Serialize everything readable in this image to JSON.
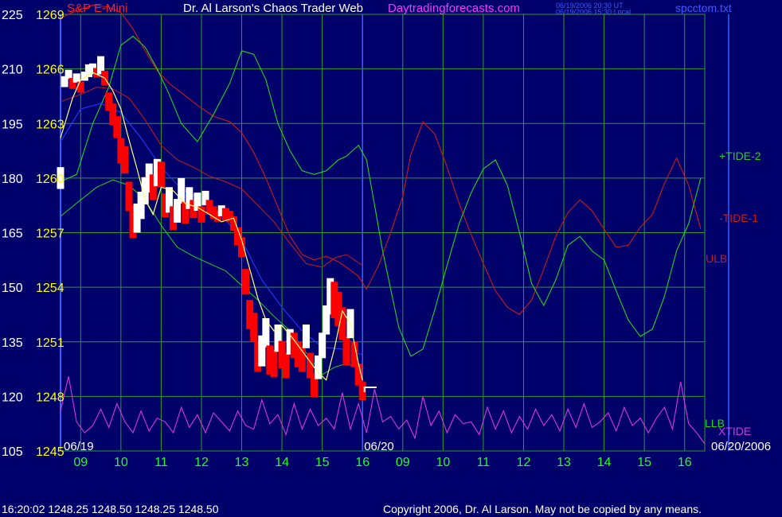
{
  "header": {
    "symbol": "S&P E-Mini",
    "title": "Dr. Al Larson's Chaos Trader Web",
    "site": "Daytradingforecasts.com",
    "stamp_ut": "06/19/2006 20:30 UT",
    "stamp_local": "06/19/2006 15:30 Local",
    "file": "spcctom.txt"
  },
  "footer": {
    "quote": "16:20:02  1248.25  1248.50  1248.25  1248.50",
    "copyright": "Copyright 2006, Dr. Al Larson. May not be copied by any means."
  },
  "colors": {
    "background": "#00006a",
    "grid": "#2f9a2f",
    "price_bars_up": "#ffffff",
    "price_bars_down": "#ff0000",
    "plus_tide_2": "#22d322",
    "minus_tide_1": "#cc1a1a",
    "xtide": "#dd33dd",
    "average": "#ffff80",
    "slow_average": "#1e3cff",
    "axis_text_left": "#ffffff",
    "axis_text_right": "#ffff00",
    "time_text": "#22ff22"
  },
  "chart_data": {
    "type": "line",
    "left_axis_ticks": [
      "225",
      "210",
      "195",
      "180",
      "165",
      "150",
      "135",
      "120",
      "105"
    ],
    "price_axis_ticks": [
      "1269",
      "1266",
      "1263",
      "1260",
      "1257",
      "1254",
      "1251",
      "1248",
      "1245"
    ],
    "price_range": [
      1245,
      1269
    ],
    "xtide_range": [
      105,
      225
    ],
    "x_ticks": [
      "09",
      "10",
      "11",
      "12",
      "13",
      "14",
      "15",
      "16",
      "09",
      "10",
      "11",
      "12",
      "13",
      "14",
      "15",
      "16"
    ],
    "x_range_hours": [
      8.5,
      24.5
    ],
    "date_labels": [
      "06/19",
      "06/20",
      "06/20/2006"
    ],
    "grid": true,
    "series_labels": [
      "+TIDE-2",
      "-TIDE-1",
      "ULB",
      "LLB",
      "XTIDE"
    ],
    "plus_tide_2": {
      "x": [
        8.5,
        8.9,
        9.3,
        9.7,
        10,
        10.3,
        10.6,
        10.9,
        11.2,
        11.5,
        11.9,
        12.3,
        12.7,
        13.0,
        13.3,
        13.6,
        13.9,
        14.2,
        14.5,
        14.8,
        15.1,
        15.4,
        15.6,
        15.9,
        16.1,
        16.5,
        16.9,
        17.2,
        17.5,
        17.8,
        18.1,
        18.4,
        18.7,
        19.0,
        19.3,
        19.6,
        19.9,
        20.2,
        20.5,
        20.8,
        21.1,
        21.4,
        21.7,
        22.0,
        22.3,
        22.6,
        22.9,
        23.2,
        23.5,
        23.8,
        24.1,
        24.4
      ],
      "y": [
        1259.8,
        1260.2,
        1263.0,
        1265.0,
        1267.3,
        1267.8,
        1267.2,
        1266.0,
        1264.6,
        1263.0,
        1262.0,
        1263.5,
        1265.2,
        1267.0,
        1266.8,
        1265.4,
        1263.0,
        1261.5,
        1260.4,
        1260.2,
        1260.4,
        1261.0,
        1261.2,
        1261.8,
        1261.0,
        1256.0,
        1251.8,
        1250.2,
        1250.6,
        1252.8,
        1255.2,
        1257.5,
        1259.2,
        1260.5,
        1261.0,
        1259.6,
        1257.0,
        1254.2,
        1253.0,
        1254.4,
        1256.3,
        1256.8,
        1256.0,
        1255.5,
        1253.8,
        1252.2,
        1251.3,
        1251.7,
        1253.5,
        1256.0,
        1257.5,
        1260.0
      ]
    },
    "minus_tide_1": {
      "x": [
        8.5,
        8.9,
        9.3,
        9.7,
        10,
        10.3,
        10.6,
        10.9,
        11.2,
        11.5,
        11.9,
        12.3,
        12.7,
        13.0,
        13.3,
        13.6,
        13.9,
        14.2,
        14.5,
        14.8,
        15.1,
        15.4,
        15.6,
        15.9,
        16.1,
        16.4,
        16.7,
        17.0,
        17.2,
        17.5,
        17.8,
        18.1,
        18.4,
        18.7,
        19.0,
        19.3,
        19.6,
        19.9,
        20.2,
        20.5,
        20.8,
        21.1,
        21.4,
        21.7,
        22.0,
        22.3,
        22.6,
        22.9,
        23.2,
        23.5,
        23.8,
        24.1,
        24.4
      ],
      "y": [
        1268.8,
        1269.2,
        1269.5,
        1269.4,
        1269.1,
        1268.2,
        1267.0,
        1265.9,
        1265.2,
        1264.7,
        1264.0,
        1263.4,
        1263.1,
        1262.5,
        1261.4,
        1260.0,
        1258.4,
        1256.8,
        1255.8,
        1255.5,
        1255.7,
        1255.4,
        1255.1,
        1254.6,
        1253.9,
        1255.2,
        1257.0,
        1259.0,
        1261.3,
        1263.1,
        1262.4,
        1260.6,
        1258.6,
        1256.9,
        1255.3,
        1253.8,
        1252.9,
        1252.5,
        1253.3,
        1255.0,
        1256.8,
        1258.1,
        1258.8,
        1258.2,
        1257.2,
        1256.2,
        1256.3,
        1257.3,
        1258.0,
        1259.7,
        1261.1,
        1259.6,
        1257.2
      ]
    },
    "ulb": {
      "x": [
        8.5,
        9.0,
        9.4,
        9.8,
        10.2,
        10.6,
        11.0,
        11.4,
        11.8,
        12.2,
        12.6,
        13.0,
        13.4,
        13.8,
        14.2,
        14.6,
        15.0,
        15.3,
        15.6,
        16.0
      ],
      "y": [
        1264.2,
        1264.6,
        1265.0,
        1264.9,
        1264.4,
        1263.2,
        1261.8,
        1261.0,
        1260.6,
        1260.1,
        1259.8,
        1259.4,
        1258.5,
        1257.6,
        1256.4,
        1255.3,
        1255.1,
        1255.6,
        1255.8,
        1255.2
      ]
    },
    "llb": {
      "x": [
        8.5,
        9.0,
        9.4,
        9.8,
        10.2,
        10.6,
        11.0,
        11.4,
        11.8,
        12.2,
        12.6,
        13.0,
        13.4,
        13.8,
        14.2,
        14.6,
        15.0,
        15.3,
        15.6,
        16.0
      ],
      "y": [
        1257.9,
        1258.8,
        1259.5,
        1259.9,
        1259.6,
        1258.8,
        1257.4,
        1256.2,
        1255.7,
        1255.3,
        1254.9,
        1254.1,
        1253.3,
        1252.4,
        1251.6,
        1250.4,
        1249.2,
        1249.6,
        1249.8,
        1249.5
      ]
    },
    "xtide": {
      "x": [
        8.5,
        8.7,
        8.9,
        9.1,
        9.3,
        9.5,
        9.7,
        9.9,
        10.1,
        10.3,
        10.5,
        10.7,
        10.9,
        11.1,
        11.3,
        11.5,
        11.7,
        11.9,
        12.1,
        12.3,
        12.5,
        12.7,
        12.9,
        13.1,
        13.3,
        13.5,
        13.7,
        13.9,
        14.1,
        14.3,
        14.5,
        14.7,
        14.9,
        15.1,
        15.3,
        15.5,
        15.7,
        15.9,
        16.1,
        16.3,
        16.5,
        16.7,
        16.9,
        17.1,
        17.3,
        17.5,
        17.7,
        17.9,
        18.1,
        18.3,
        18.5,
        18.7,
        18.9,
        19.1,
        19.3,
        19.5,
        19.7,
        19.9,
        20.1,
        20.3,
        20.5,
        20.7,
        20.9,
        21.1,
        21.3,
        21.5,
        21.7,
        21.9,
        22.1,
        22.3,
        22.5,
        22.7,
        22.9,
        23.1,
        23.3,
        23.5,
        23.7,
        23.9,
        24.1,
        24.3,
        24.5
      ],
      "y": [
        116.0,
        125.5,
        113.0,
        110.0,
        112.0,
        116.5,
        111.5,
        118.0,
        113.0,
        110.0,
        116.0,
        110.5,
        114.0,
        113.0,
        110.0,
        117.0,
        111.5,
        115.0,
        110.0,
        115.5,
        113.0,
        110.5,
        116.0,
        112.0,
        111.0,
        119.0,
        112.5,
        115.0,
        109.5,
        118.0,
        111.0,
        116.5,
        112.0,
        114.0,
        111.0,
        121.0,
        111.0,
        118.0,
        110.0,
        122.0,
        113.0,
        114.5,
        111.0,
        113.5,
        108.5,
        120.0,
        112.0,
        116.0,
        110.0,
        115.0,
        112.5,
        113.0,
        109.5,
        117.0,
        111.0,
        116.0,
        110.0,
        114.5,
        111.0,
        116.5,
        112.0,
        115.0,
        110.5,
        116.5,
        111.5,
        118.0,
        111.5,
        113.0,
        115.5,
        110.5,
        117.0,
        112.0,
        114.0,
        110.0,
        114.0,
        117.0,
        111.0,
        124.0,
        112.5,
        110.0,
        107.0
      ]
    },
    "slow_average": {
      "x": [
        8.5,
        9.0,
        9.5,
        10.0,
        10.5,
        11.0,
        11.5,
        12.0,
        12.5,
        13.0,
        13.5,
        14.0,
        14.5,
        15.0,
        15.5,
        16.0
      ],
      "y": [
        1262.0,
        1263.8,
        1264.1,
        1263.6,
        1262.2,
        1260.6,
        1259.4,
        1258.8,
        1258.0,
        1256.6,
        1254.4,
        1252.9,
        1251.6,
        1250.7,
        1250.6,
        1250.3
      ]
    },
    "average": {
      "x": [
        8.5,
        8.8,
        9.0,
        9.3,
        9.6,
        9.8,
        10.0,
        10.2,
        10.4,
        10.6,
        10.8,
        11.0,
        11.3,
        11.6,
        11.9,
        12.2,
        12.5,
        12.8,
        13.0,
        13.2,
        13.4,
        13.6,
        13.8,
        14.0,
        14.3,
        14.6,
        14.9,
        15.1,
        15.3,
        15.5,
        15.7,
        15.9,
        16.0
      ],
      "y": [
        1262.2,
        1264.4,
        1265.4,
        1265.8,
        1265.5,
        1264.8,
        1263.8,
        1262.1,
        1260.5,
        1258.8,
        1258.0,
        1259.5,
        1259.3,
        1258.6,
        1258.4,
        1258.0,
        1257.6,
        1257.8,
        1256.6,
        1255.0,
        1253.4,
        1252.2,
        1251.6,
        1251.9,
        1251.1,
        1250.2,
        1249.3,
        1248.9,
        1250.6,
        1252.7,
        1252.0,
        1249.8,
        1248.9
      ]
    },
    "price_path": {
      "x": [
        8.5,
        8.6,
        8.7,
        8.8,
        8.9,
        9.0,
        9.1,
        9.2,
        9.3,
        9.4,
        9.5,
        9.6,
        9.7,
        9.8,
        9.9,
        10.0,
        10.1,
        10.2,
        10.3,
        10.4,
        10.5,
        10.6,
        10.7,
        10.8,
        10.9,
        11.0,
        11.1,
        11.2,
        11.3,
        11.4,
        11.5,
        11.6,
        11.7,
        11.8,
        11.9,
        12.0,
        12.1,
        12.2,
        12.3,
        12.4,
        12.5,
        12.6,
        12.7,
        12.8,
        12.9,
        13.0,
        13.1,
        13.2,
        13.3,
        13.4,
        13.5,
        13.6,
        13.7,
        13.8,
        13.9,
        14.0,
        14.1,
        14.2,
        14.3,
        14.4,
        14.5,
        14.6,
        14.7,
        14.8,
        14.9,
        15.0,
        15.1,
        15.2,
        15.3,
        15.4,
        15.5,
        15.6,
        15.7,
        15.8,
        15.9,
        16.0
      ],
      "y": [
        1260.0,
        1265.3,
        1265.7,
        1265.2,
        1265.5,
        1265.0,
        1265.6,
        1265.9,
        1266.0,
        1265.8,
        1266.2,
        1265.5,
        1264.2,
        1263.5,
        1262.8,
        1261.5,
        1261.0,
        1259.0,
        1257.6,
        1257.8,
        1258.5,
        1259.3,
        1260.0,
        1259.5,
        1260.3,
        1260.2,
        1258.5,
        1258.8,
        1257.8,
        1258.2,
        1259.3,
        1258.1,
        1258.9,
        1258.3,
        1258.7,
        1258.0,
        1258.9,
        1258.4,
        1258.1,
        1257.9,
        1258.2,
        1258.0,
        1257.9,
        1257.5,
        1256.8,
        1256.2,
        1254.3,
        1252.5,
        1251.8,
        1250.2,
        1250.5,
        1251.5,
        1250.0,
        1249.8,
        1251.2,
        1250.3,
        1249.7,
        1251.0,
        1250.8,
        1250.3,
        1250.0,
        1251.3,
        1249.7,
        1248.6,
        1249.6,
        1250.8,
        1252.2,
        1253.5,
        1253.3,
        1252.8,
        1252.0,
        1250.5,
        1252.0,
        1250.3,
        1249.2,
        1248.3
      ],
      "range": [
        1.2,
        0.6,
        0.5,
        0.6,
        0.5,
        0.6,
        0.5,
        0.7,
        0.6,
        0.5,
        1.0,
        0.8,
        1.0,
        1.2,
        1.2,
        1.4,
        1.5,
        1.6,
        1.8,
        1.6,
        1.5,
        1.5,
        1.6,
        1.4,
        1.5,
        1.4,
        1.3,
        1.4,
        1.3,
        1.3,
        1.4,
        1.2,
        1.2,
        1.0,
        1.0,
        0.9,
        0.8,
        0.8,
        0.7,
        0.6,
        0.6,
        0.7,
        0.6,
        0.8,
        1.0,
        1.1,
        1.4,
        1.6,
        1.6,
        1.7,
        1.7,
        1.6,
        1.6,
        1.5,
        1.5,
        1.5,
        1.4,
        1.4,
        1.4,
        1.4,
        1.3,
        1.3,
        1.4,
        1.3,
        1.3,
        1.4,
        1.6,
        2.0,
        2.0,
        1.9,
        1.8,
        1.6,
        1.6,
        1.4,
        1.2,
        1.0
      ]
    },
    "last_quote": 1248.5
  }
}
